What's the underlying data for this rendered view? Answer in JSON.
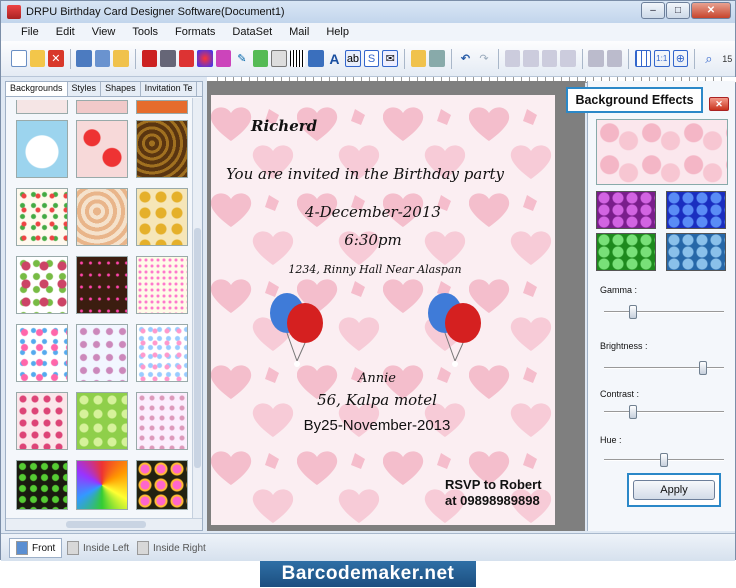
{
  "window": {
    "title": "DRPU Birthday Card Designer Software(Document1)"
  },
  "menu": [
    "File",
    "Edit",
    "View",
    "Tools",
    "Formats",
    "DataSet",
    "Mail",
    "Help"
  ],
  "left_panel": {
    "tabs": [
      "Backgrounds",
      "Styles",
      "Shapes",
      "Invitation Te"
    ]
  },
  "card": {
    "name": "Richerd",
    "invite": "You are invited in the Birthday party",
    "date": "4-December-2013",
    "time": "6:30pm",
    "address": "1234, Rinny Hall Near Alaspan",
    "host": "Annie",
    "venue": "56, Kalpa motel",
    "by_date": "By25-November-2013",
    "rsvp": "RSVP to Robert",
    "phone": "at 09898989898"
  },
  "right_panel": {
    "title": "Background Effects",
    "gamma_label": "Gamma :",
    "brightness_label": "Brightness :",
    "contrast_label": "Contrast :",
    "hue_label": "Hue :",
    "apply_label": "Apply",
    "gamma": 0.22,
    "brightness": 0.85,
    "contrast": 0.22,
    "hue": 0.5
  },
  "status_tabs": [
    "Front",
    "Inside Left",
    "Inside Right"
  ],
  "footer": "Barcodemaker.net",
  "ruler_label": "15",
  "colors": {
    "accent": "#2b88c8",
    "card_bg": "#fbeef2",
    "heart": "#f4b6c6",
    "footer_bg": "#1c4f80"
  }
}
